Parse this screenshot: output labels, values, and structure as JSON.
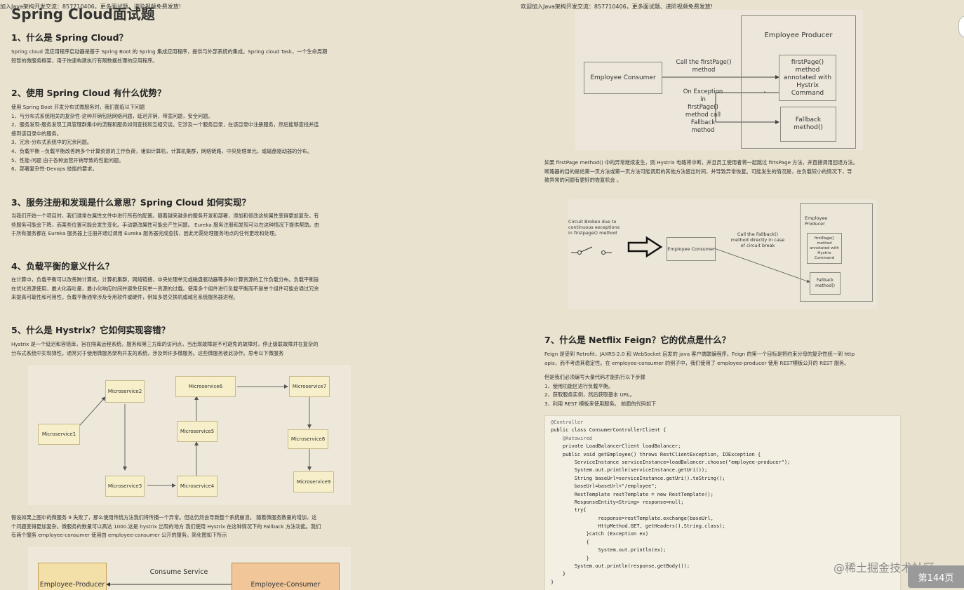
{
  "left": {
    "topnote": "加入Java架构开发交流：857710406，更多面试题、进阶视频免费发放!",
    "title": "Spring Cloud面试题",
    "sections": [
      {
        "heading": "1、什么是 Spring Cloud？",
        "lines": [
          "Spring cloud 流应用程序启动器是基于 Spring Boot 的 Spring 集成应用程序，提供与外部系统的集成。Spring cloud Task，一个生命周期",
          "短暂的微服务框架，用于快速构建执行有限数据处理的应用程序。"
        ]
      },
      {
        "heading": "2、使用 Spring Cloud 有什么优势？",
        "lines": [
          "使用 Spring Boot 开发分布式微服务时，我们面临以下问题",
          "1、与分布式系统相关的复杂性-这种开销包括网络问题，延迟开销，带宽问题，安全问题。",
          "2、服务发现-服务发现工具管理群集中的流程和服务如何查找和互相交谈。它涉及一个服务目录，在该目录中注册服务，然后能够查找并连",
          "接到该目录中的服务。",
          "3、冗余-分布式系统中的冗余问题。",
          "4、负载平衡 --负载平衡改善跨多个计算资源的工作负荷，诸如计算机，计算机集群，网络链路，中央处理单元，或磁盘驱动器的分布。",
          "5、性能-问题 由于各种运营开销导致的性能问题。",
          "6、部署复杂性-Devops 技能的要求。"
        ]
      },
      {
        "heading": "3、服务注册和发现是什么意思？Spring Cloud 如何实现？",
        "lines": [
          "当我们开始一个项目时，我们通常在属性文件中进行所有的配置。随着越来越多的服务开发和部署，添加和修改这些属性变得更加复杂。有",
          "些服务可能会下降，而某些位置可能会发生变化。手动更改属性可能会产生问题。 Eureka 服务注册和发现可以在这种情况下提供帮助。由",
          "于所有服务都在 Eureka 服务器上注册并通过调用 Eureka 服务器完成查找，因此无需处理服务地点的任何更改和处理。"
        ]
      },
      {
        "heading": "4、负载平衡的意义什么？",
        "lines": [
          "在计算中，负载平衡可以改善跨计算机，计算机集群，网络链接，中央处理单元或磁盘驱动器等多种计算资源的工作负载分布。负载平衡旨",
          "在优化资源使用，最大化吞吐量，最小化响应时间并避免任何单一资源的过载。使用多个组件进行负载平衡而不是单个组件可能会通过冗余",
          "来提高可靠性和可用性。负载平衡通常涉及专用软件或硬件，例如多层交换机或域名系统服务器进程。"
        ]
      },
      {
        "heading": "5、什么是 Hystrix？它如何实现容错？",
        "lines": [
          "Hystrix 是一个延迟和容错库，旨在隔离远程系统，服务和第三方库的访问点，当出现故障是不可避免的故障时，停止级联故障并在复杂的",
          "分布式系统中实现弹性。通常对于使用微服务架构开发的系统，涉及到许多微服务。这些微服务彼此协作。思考以下微服务"
        ]
      }
    ],
    "after_diagram": [
      "假设如果上图中的微服务 9 失败了，那么使用传统方法我们将传播一个异常。但这仍然会导致整个系统崩溃。 随着微服务数量的增加，这",
      "个问题变得更加复杂。微服务的数量可以高达 1000.这是 hystrix 出现的地方 我们使用 Hystrix 在这种情况下的 Fallback 方法功能。我们",
      "有两个服务 employee-consumer 使用由 employee-consumer 公开的服务。简化图如下所示"
    ],
    "microservices": [
      "Microservice1",
      "Microservice2",
      "Microservice3",
      "Microservice4",
      "Microservice5",
      "Microservice6",
      "Microservice7",
      "Microservice8",
      "Microservice9"
    ],
    "bottom_diagram": {
      "producer": "Employee-Producer",
      "service": "Consume Service",
      "consumer": "Employee-Consumer"
    }
  },
  "right": {
    "topnote": "欢迎加入Java架构开发交流：857710406，更多面试题、进阶视频免费发放!",
    "fig1": {
      "producer_title": "Employee Producer",
      "consumer": "Employee Consumer",
      "call_label": "Call the firstPage()\nmethod",
      "first_page": "firstPage()\nmethod\nannotated with\nHystrix\nCommand",
      "exception_label": "On Exception\nin\nfirstPage()\nmethod call\nFallback\nmethod",
      "fallback": "Fallback\nmethod()"
    },
    "para1": [
      "如果 firstPage method() 中的异常继续发生，则 Hystrix 电路将中断，并且员工使用者将一起跳过 firtsPage 方法，并直接调用回退方法。",
      "断路器的目的是给第一页方法或第一页方法可能调用的其他方法留出时间，并导致异常恢复。可能发生的情况是，在负载较小的情况下，导",
      "致异常的问题有更好的恢复机会 。"
    ],
    "fig2": {
      "circuit_label": "Circuit Broken due to\ncontinuous exceptions\nin firstpage() method",
      "consumer": "Employee Consumer",
      "call_label": "Call the Fallback()\nmethod directly in case\nof circuit break",
      "producer_title": "Employee\nProducer",
      "first_page": "firstPage()\nmethod\nannotated with\nHystrix\nCommand",
      "fallback": "Fallback\nmethod()"
    },
    "section7": {
      "heading": "7、什么是 Netflix Feign？它的优点是什么？",
      "lines": [
        "Feign 是受到 Retrofit，JAXRS-2.0 和 WebSocket 启发的 java 客户端联编程序。Feign 的第一个目标是将约束分母的复杂性统一到 http",
        "apis，而不考虑其稳定性。在 employee-consumer 的例子中，我们使用了 employee-producer 使用 REST模板公开的 REST 服务。"
      ],
      "lines2": [
        "但是我们必须编写大量代码才能执行以下步骤",
        "1、使用功能区进行负载平衡。",
        "2、获取服务实例，然后获取基本 URL。",
        "3、利用 REST 模板来使用服务。 前面的代码如下"
      ]
    },
    "code": [
      "@Controller",
      "public class ConsumerControllerClient {",
      "    @Autowired",
      "    private LoadBalancerClient loadBalancer;",
      "    public void getEmployee() throws RestClientException, IOException {",
      "        ServiceInstance serviceInstance=loadBalancer.choose(\"employee-producer\");",
      "        System.out.println(serviceInstance.getUri());",
      "        String baseUrl=serviceInstance.getUri().toString();",
      "        baseUrl=baseUrl+\"/employee\";",
      "        RestTemplate restTemplate = new RestTemplate();",
      "        ResponseEntity<String> response=null;",
      "        try{",
      "                response=restTemplate.exchange(baseUrl,",
      "                HttpMethod.GET, getHeaders(),String.class);",
      "            }catch (Exception ex)",
      "            {",
      "                System.out.println(ex);",
      "            }",
      "        System.out.println(response.getBody());",
      "    }",
      "}"
    ]
  },
  "watermark": "@稀土掘金技术社区",
  "page_badge": "第144页"
}
